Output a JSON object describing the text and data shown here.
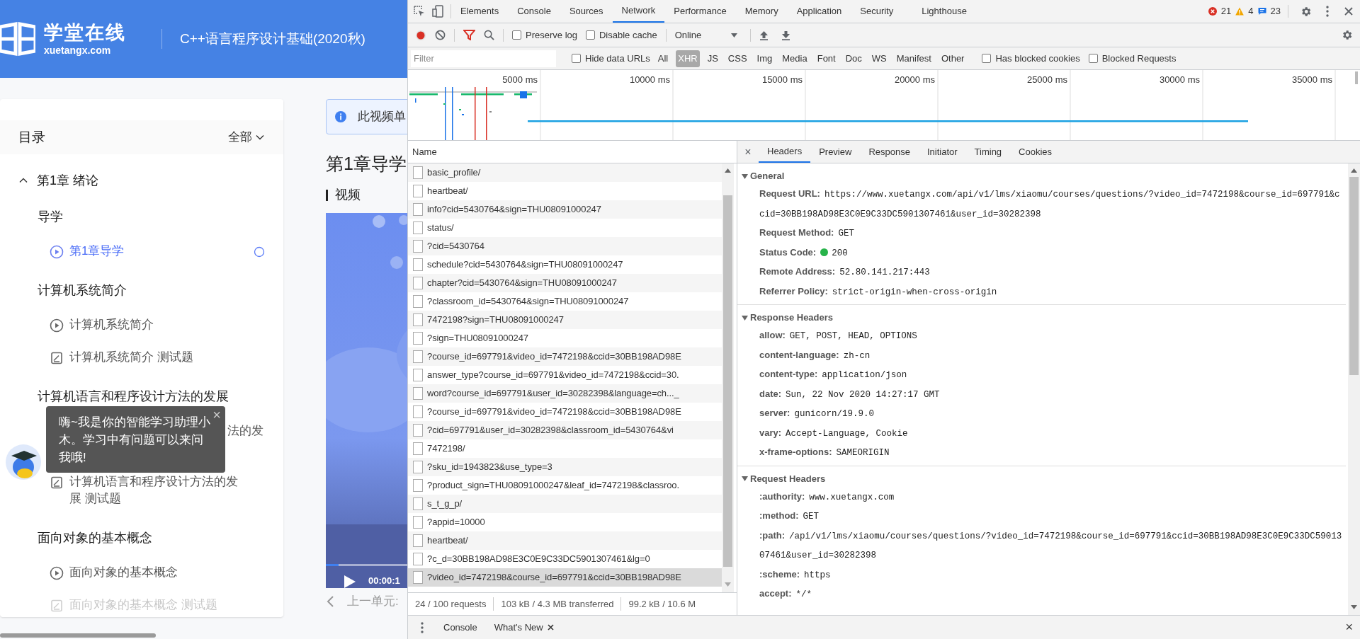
{
  "site": {
    "logo_text": "学堂在线",
    "logo_domain": "xuetangx.com",
    "course_title": "C++语言程序设计基础(2020秋)"
  },
  "sidebar": {
    "title": "目录",
    "filter": "全部",
    "chapters": [
      {
        "title": "第1章 绪论",
        "expanded": true,
        "sections": [
          {
            "title": "导学",
            "items": [
              {
                "kind": "video",
                "title": "第1章导学",
                "selected": true
              }
            ]
          },
          {
            "title": "计算机系统简介",
            "items": [
              {
                "kind": "video",
                "title": "计算机系统简介",
                "selected": false
              },
              {
                "kind": "quiz",
                "title": "计算机系统简介 测试题",
                "selected": false
              }
            ]
          },
          {
            "title": "计算机语言和程序设计方法的发展",
            "items": [
              {
                "kind": "video",
                "title": "法的发",
                "selected": false,
                "covered": true
              },
              {
                "kind": "quiz",
                "title": "计算机语言和程序设计方法的发展 测试题",
                "selected": false
              }
            ]
          },
          {
            "title": "面向对象的基本概念",
            "items": [
              {
                "kind": "video",
                "title": "面向对象的基本概念",
                "selected": false
              },
              {
                "kind": "quiz",
                "title": "面向对象的基本概念 测试题",
                "selected": false
              }
            ]
          }
        ]
      }
    ]
  },
  "assistant_tip": {
    "text": "嗨~我是你的智能学习助理小木。学习中有问题可以来问我哦!",
    "close": "×"
  },
  "main": {
    "notice": "此视频单",
    "heading": "第1章导学",
    "section": "视频",
    "video_time": "00:00:1",
    "video_progress": {
      "level": 0.03
    },
    "prev_unit": "上一单元:"
  },
  "devtools": {
    "tabs": [
      {
        "label": "Elements",
        "selected": false
      },
      {
        "label": "Console",
        "selected": false
      },
      {
        "label": "Sources",
        "selected": false
      },
      {
        "label": "Network",
        "selected": true
      },
      {
        "label": "Performance",
        "selected": false
      },
      {
        "label": "Memory",
        "selected": false
      },
      {
        "label": "Application",
        "selected": false
      },
      {
        "label": "Security",
        "selected": false
      },
      {
        "label": "Lighthouse",
        "selected": false
      }
    ],
    "counts": {
      "errors": "21",
      "warnings": "4",
      "messages": "23"
    },
    "toolbar": {
      "recording": true,
      "filter_active": true,
      "preserve_log": {
        "label": "Preserve log",
        "checked": false
      },
      "disable_cache": {
        "label": "Disable cache",
        "checked": false
      },
      "throttling": "Online"
    },
    "filter_bar": {
      "placeholder": "Filter",
      "hide_data_urls": {
        "label": "Hide data URLs",
        "checked": false
      },
      "types": [
        {
          "label": "All",
          "selected": false
        },
        {
          "label": "XHR",
          "selected": true
        },
        {
          "label": "JS",
          "selected": false
        },
        {
          "label": "CSS",
          "selected": false
        },
        {
          "label": "Img",
          "selected": false
        },
        {
          "label": "Media",
          "selected": false
        },
        {
          "label": "Font",
          "selected": false
        },
        {
          "label": "Doc",
          "selected": false
        },
        {
          "label": "WS",
          "selected": false
        },
        {
          "label": "Manifest",
          "selected": false
        },
        {
          "label": "Other",
          "selected": false
        }
      ],
      "has_blocked_cookies": {
        "label": "Has blocked cookies",
        "checked": false
      },
      "blocked_requests": {
        "label": "Blocked Requests",
        "checked": false
      }
    },
    "timeline": {
      "ticks": [
        "5000 ms",
        "10000 ms",
        "15000 ms",
        "20000 ms",
        "25000 ms",
        "30000 ms",
        "35000 ms"
      ]
    },
    "requests": {
      "column": "Name",
      "rows": [
        {
          "name": "basic_profile/",
          "selected": false
        },
        {
          "name": "heartbeat/",
          "selected": false
        },
        {
          "name": "info?cid=5430764&sign=THU08091000247",
          "selected": false
        },
        {
          "name": "status/",
          "selected": false
        },
        {
          "name": "?cid=5430764",
          "selected": false
        },
        {
          "name": "schedule?cid=5430764&sign=THU08091000247",
          "selected": false
        },
        {
          "name": "chapter?cid=5430764&sign=THU08091000247",
          "selected": false
        },
        {
          "name": "?classroom_id=5430764&sign=THU08091000247",
          "selected": false
        },
        {
          "name": "7472198?sign=THU08091000247",
          "selected": false
        },
        {
          "name": "?sign=THU08091000247",
          "selected": false
        },
        {
          "name": "?course_id=697791&video_id=7472198&ccid=30BB198AD98E",
          "selected": false
        },
        {
          "name": "answer_type?course_id=697791&video_id=7472198&ccid=30.",
          "selected": false
        },
        {
          "name": "word?course_id=697791&user_id=30282398&language=ch..._",
          "selected": false
        },
        {
          "name": "?course_id=697791&video_id=7472198&ccid=30BB198AD98E",
          "selected": false
        },
        {
          "name": "?cid=697791&user_id=30282398&classroom_id=5430764&vi",
          "selected": false
        },
        {
          "name": "7472198/",
          "selected": false
        },
        {
          "name": "?sku_id=1943823&use_type=3",
          "selected": false
        },
        {
          "name": "?product_sign=THU08091000247&leaf_id=7472198&classroo.",
          "selected": false
        },
        {
          "name": "s_t_g_p/",
          "selected": false
        },
        {
          "name": "?appid=10000",
          "selected": false
        },
        {
          "name": "heartbeat/",
          "selected": false
        },
        {
          "name": "?c_d=30BB198AD98E3C0E9C33DC5901307461&lg=0",
          "selected": false
        },
        {
          "name": "?video_id=7472198&course_id=697791&ccid=30BB198AD98E",
          "selected": true
        }
      ],
      "summary": [
        "24 / 100 requests",
        "103 kB / 4.3 MB transferred",
        "99.2 kB / 10.6 M"
      ]
    },
    "detail": {
      "close": "×",
      "tabs": [
        {
          "label": "Headers",
          "selected": true
        },
        {
          "label": "Preview",
          "selected": false
        },
        {
          "label": "Response",
          "selected": false
        },
        {
          "label": "Initiator",
          "selected": false
        },
        {
          "label": "Timing",
          "selected": false
        },
        {
          "label": "Cookies",
          "selected": false
        }
      ],
      "sections": [
        {
          "title": "General",
          "expanded": true,
          "rows": [
            {
              "key": "Request URL:",
              "value": "https://www.xuetangx.com/api/v1/lms/xiaomu/courses/questions/?video_id=7472198&course_id=697791&ccid=30BB198AD98E3C0E9C33DC5901307461&user_id=30282398"
            },
            {
              "key": "Request Method:",
              "value": "GET"
            },
            {
              "key": "Status Code:",
              "value": "200",
              "kind": "status"
            },
            {
              "key": "Remote Address:",
              "value": "52.80.141.217:443"
            },
            {
              "key": "Referrer Policy:",
              "value": "strict-origin-when-cross-origin"
            }
          ]
        },
        {
          "title": "Response Headers",
          "expanded": true,
          "rows": [
            {
              "key": "allow:",
              "value": "GET, POST, HEAD, OPTIONS"
            },
            {
              "key": "content-language:",
              "value": "zh-cn"
            },
            {
              "key": "content-type:",
              "value": "application/json"
            },
            {
              "key": "date:",
              "value": "Sun, 22 Nov 2020 14:27:17 GMT"
            },
            {
              "key": "server:",
              "value": "gunicorn/19.9.0"
            },
            {
              "key": "vary:",
              "value": "Accept-Language, Cookie"
            },
            {
              "key": "x-frame-options:",
              "value": "SAMEORIGIN"
            }
          ]
        },
        {
          "title": "Request Headers",
          "expanded": true,
          "rows": [
            {
              "key": ":authority:",
              "value": "www.xuetangx.com"
            },
            {
              "key": ":method:",
              "value": "GET"
            },
            {
              "key": ":path:",
              "value": "/api/v1/lms/xiaomu/courses/questions/?video_id=7472198&course_id=697791&ccid=30BB198AD98E3C0E9C33DC5901307461&user_id=30282398"
            },
            {
              "key": ":scheme:",
              "value": "https"
            },
            {
              "key": "accept:",
              "value": "*/*"
            }
          ]
        }
      ]
    },
    "drawer": {
      "tabs": [
        {
          "label": "Console",
          "closable": false
        },
        {
          "label": "What's New",
          "closable": true
        }
      ],
      "close": "×"
    }
  }
}
